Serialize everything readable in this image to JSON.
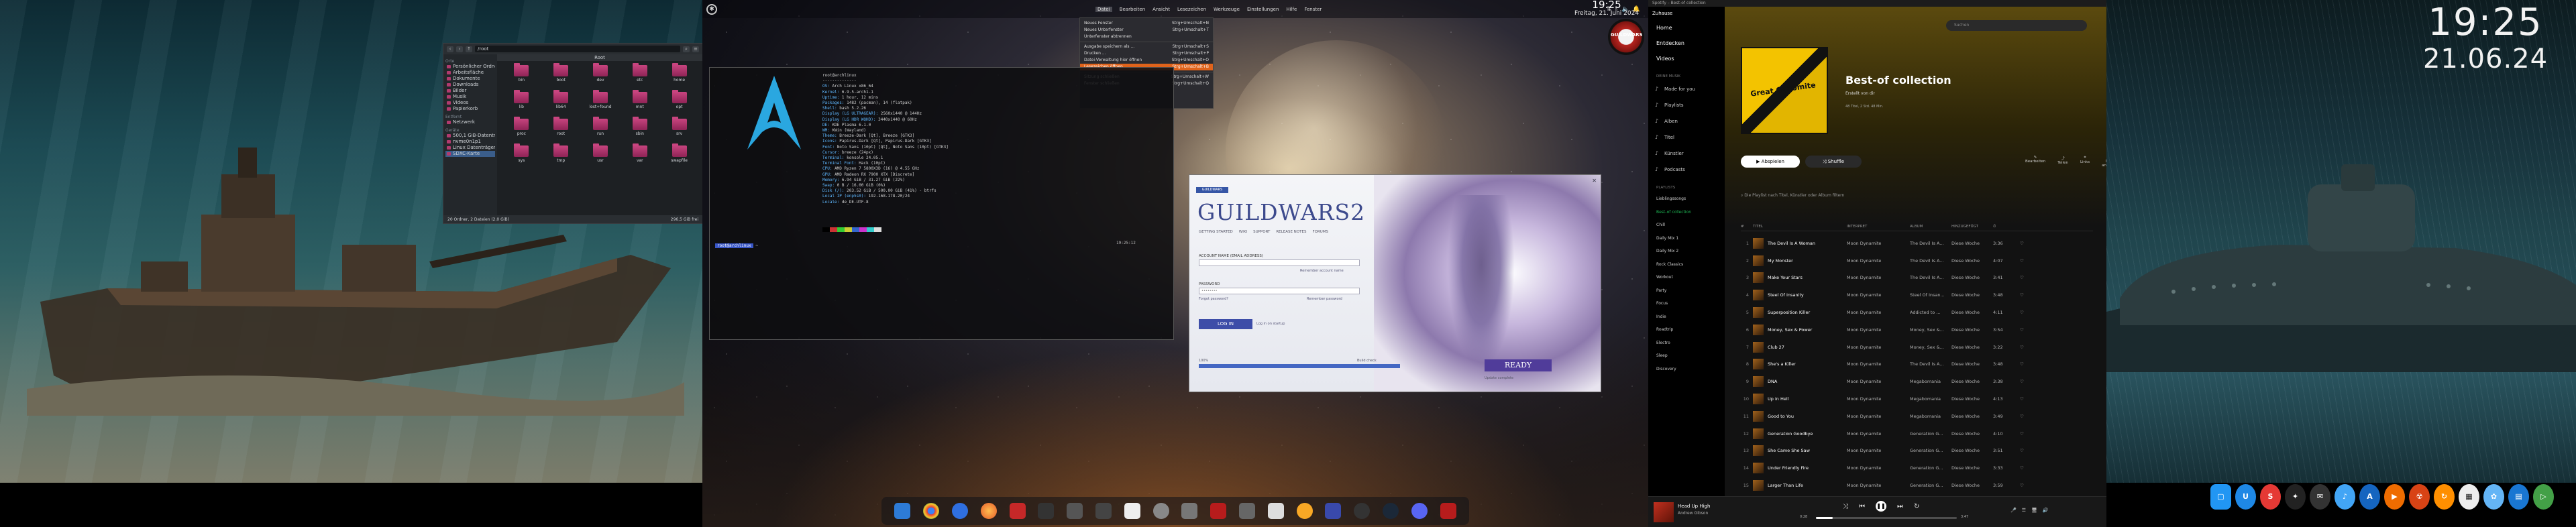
{
  "top_bar": {
    "menus": [
      "Datei",
      "Bearbeiten",
      "Ansicht",
      "Lesezeichen",
      "Werkzeuge",
      "Einstellungen",
      "Hilfe",
      "Fenster"
    ],
    "active_menu": "Datei",
    "time": "19:25",
    "date": "Freitag, 21. Juni 2024",
    "badge_text": "GUILDWARS"
  },
  "file_menu": {
    "items": [
      {
        "label": "Neues Fenster",
        "shortcut": "Strg+Umschalt+N"
      },
      {
        "label": "Neues Unterfenster",
        "shortcut": "Strg+Umschalt+T"
      },
      {
        "label": "Unterfenster abtrennen",
        "shortcut": ""
      },
      {
        "label": "Ausgabe speichern als ...",
        "shortcut": "Strg+Umschalt+S"
      },
      {
        "label": "Drucken ...",
        "shortcut": "Strg+Umschalt+P"
      },
      {
        "label": "Datei-Verwaltung hier öffnen",
        "shortcut": "Strg+Umschalt+O"
      },
      {
        "label": "Lesezeichen öffnen",
        "shortcut": "Strg+Umschalt+B",
        "highlighted": true
      },
      {
        "label": "Sitzung schließen",
        "shortcut": "Strg+Umschalt+W"
      },
      {
        "label": "Fenster schließen",
        "shortcut": "Strg+Umschalt+Q"
      }
    ]
  },
  "file_manager": {
    "path": "/root",
    "tab": "Root",
    "sidebar": {
      "places_title": "Orte",
      "places": [
        "Persönlicher Ordner",
        "Arbeitsfläche",
        "Dokumente",
        "Downloads",
        "Bilder",
        "Musik",
        "Videos",
        "Papierkorb"
      ],
      "remote_title": "Entfernt",
      "remote": [
        "Netzwerk"
      ],
      "devices_title": "Geräte",
      "devices": [
        "500,1 GiB-Datenträger",
        "nvme0n1p1",
        "Linux Datenträger",
        "SDXC-Karte"
      ],
      "selected": "SDXC-Karte"
    },
    "folders": [
      "bin",
      "boot",
      "dev",
      "etc",
      "home",
      "lib",
      "lib64",
      "lost+found",
      "mnt",
      "opt",
      "proc",
      "root",
      "run",
      "sbin",
      "srv",
      "sys",
      "tmp",
      "usr",
      "var",
      "swapfile"
    ],
    "status_left": "20 Ordner, 2 Dateien (2,0 GiB)",
    "status_right": "296,5 GiB frei"
  },
  "terminal": {
    "info_lines": [
      {
        "k": "",
        "v": "root@archlinux"
      },
      {
        "k": "",
        "v": "--------------"
      },
      {
        "k": "OS:",
        "v": "Arch Linux x86_64"
      },
      {
        "k": "Kernel:",
        "v": "6.9.5-arch1-1"
      },
      {
        "k": "Uptime:",
        "v": "1 hour, 12 mins"
      },
      {
        "k": "Packages:",
        "v": "1482 (pacman), 14 (flatpak)"
      },
      {
        "k": "Shell:",
        "v": "bash 5.2.26"
      },
      {
        "k": "Display (LG ULTRAGEAR):",
        "v": "2560x1440 @ 144Hz"
      },
      {
        "k": "Display (LG HDR WQHD):",
        "v": "3440x1440 @ 60Hz"
      },
      {
        "k": "DE:",
        "v": "KDE Plasma 6.1.0"
      },
      {
        "k": "WM:",
        "v": "KWin (Wayland)"
      },
      {
        "k": "Theme:",
        "v": "Breeze-Dark [Qt], Breeze [GTK3]"
      },
      {
        "k": "Icons:",
        "v": "Papirus-Dark [Qt], Papirus-Dark [GTK3]"
      },
      {
        "k": "Font:",
        "v": "Noto Sans (10pt) [Qt], Noto Sans (10pt) [GTK3]"
      },
      {
        "k": "Cursor:",
        "v": "breeze (24px)"
      },
      {
        "k": "Terminal:",
        "v": "konsole 24.05.1"
      },
      {
        "k": "Terminal Font:",
        "v": "Hack (10pt)"
      },
      {
        "k": "CPU:",
        "v": "AMD Ryzen 7 5800X3D (16) @ 4.55 GHz"
      },
      {
        "k": "GPU:",
        "v": "AMD Radeon RX 7900 XTX [Discrete]"
      },
      {
        "k": "Memory:",
        "v": "6.94 GiB / 31.27 GiB (22%)"
      },
      {
        "k": "Swap:",
        "v": "0 B / 16.00 GiB (0%)"
      },
      {
        "k": "Disk (/):",
        "v": "203.52 GiB / 500.00 GiB (41%) - btrfs"
      },
      {
        "k": "Local IP (enp5s0):",
        "v": "192.168.178.20/24"
      },
      {
        "k": "Locale:",
        "v": "de_DE.UTF-8"
      }
    ],
    "prompt_user": "root@archlinux",
    "prompt_dir": "~",
    "prompt_time": "19:25:12"
  },
  "gw2_launcher": {
    "tag": "GUILDWARS",
    "title": "GUILDWARS2",
    "nav": [
      "GETTING STARTED",
      "WIKI",
      "SUPPORT",
      "RELEASE NOTES",
      "FORUMS"
    ],
    "account_label": "ACCOUNT NAME (EMAIL ADDRESS)",
    "account_placeholder": "",
    "forgot_account": "Remember account name",
    "password_label": "PASSWORD",
    "password_value": "••••••••",
    "forgot_password": "Forgot password?",
    "remember_password": "Remember password",
    "login": "LOG IN",
    "remember_me": "Log in on startup",
    "progress_label": "100%",
    "progress": 1.0,
    "progress_note": "Build check",
    "ready": "READY",
    "footer": "Update complete"
  },
  "spotify": {
    "title": "Spotify – Best-of collection",
    "sidebar_head": "Zuhause",
    "nav": [
      "Home",
      "Entdecken",
      "Videos"
    ],
    "library_title": "DEINE MUSIK",
    "library": [
      "Made for you",
      "Playlists",
      "Alben",
      "Titel",
      "Künstler",
      "Podcasts"
    ],
    "playlists_title": "PLAYLISTS",
    "playlists": [
      "Lieblingssongs",
      "Best-of collection",
      "Chill",
      "Daily Mix 1",
      "Daily Mix 2",
      "Rock Classics",
      "Workout",
      "Party",
      "Focus",
      "Indie",
      "Roadtrip",
      "Electro",
      "Sleep",
      "Discovery"
    ],
    "active_playlist": "Best-of collection",
    "search_placeholder": "Suchen",
    "cover_text": "Great Gynomite",
    "playlist_title": "Best-of collection",
    "playlist_sub": "Erstellt von dir",
    "playlist_meta": "48 Titel, 2 Std. 48 Min.",
    "play": "Abspielen",
    "shuffle": "Shuffle",
    "actions": [
      "Bearbeiten",
      "Teilen",
      "Links",
      "Mehr anzeigen"
    ],
    "filter": "Die Playlist nach Titel, Künstler oder Album filtern",
    "columns": [
      "#",
      "TITEL",
      "INTERPRET",
      "ALBUM",
      "HINZUGEFÜGT",
      "⏱"
    ],
    "tracks": [
      {
        "n": "1",
        "t": "The Devil Is A Woman",
        "a": "Moon Dynamite",
        "al": "The Devil Is A...",
        "d": "Diese Woche",
        "du": "3:36"
      },
      {
        "n": "2",
        "t": "My Monster",
        "a": "Moon Dynamite",
        "al": "The Devil Is A...",
        "d": "Diese Woche",
        "du": "4:07"
      },
      {
        "n": "3",
        "t": "Make Your Stars",
        "a": "Moon Dynamite",
        "al": "The Devil Is A...",
        "d": "Diese Woche",
        "du": "3:41"
      },
      {
        "n": "4",
        "t": "Steel Of Insanity",
        "a": "Moon Dynamite",
        "al": "Steel Of Insan...",
        "d": "Diese Woche",
        "du": "3:48"
      },
      {
        "n": "5",
        "t": "Superposition Killer",
        "a": "Moon Dynamite",
        "al": "Addicted to ...",
        "d": "Diese Woche",
        "du": "4:11"
      },
      {
        "n": "6",
        "t": "Money, Sex & Power",
        "a": "Moon Dynamite",
        "al": "Money, Sex &...",
        "d": "Diese Woche",
        "du": "3:54"
      },
      {
        "n": "7",
        "t": "Club 27",
        "a": "Moon Dynamite",
        "al": "Money, Sex &...",
        "d": "Diese Woche",
        "du": "3:22"
      },
      {
        "n": "8",
        "t": "She's a Killer",
        "a": "Moon Dynamite",
        "al": "The Devil Is A...",
        "d": "Diese Woche",
        "du": "3:48"
      },
      {
        "n": "9",
        "t": "DNA",
        "a": "Moon Dynamite",
        "al": "Megabomania",
        "d": "Diese Woche",
        "du": "3:38"
      },
      {
        "n": "10",
        "t": "Up in Hell",
        "a": "Moon Dynamite",
        "al": "Megabomania",
        "d": "Diese Woche",
        "du": "4:13"
      },
      {
        "n": "11",
        "t": "Good to You",
        "a": "Moon Dynamite",
        "al": "Megabomania",
        "d": "Diese Woche",
        "du": "3:49"
      },
      {
        "n": "12",
        "t": "Generation Goodbye",
        "a": "Moon Dynamite",
        "al": "Generation G...",
        "d": "Diese Woche",
        "du": "4:10"
      },
      {
        "n": "13",
        "t": "She Came She Saw",
        "a": "Moon Dynamite",
        "al": "Generation G...",
        "d": "Diese Woche",
        "du": "3:51"
      },
      {
        "n": "14",
        "t": "Under Friendly Fire",
        "a": "Moon Dynamite",
        "al": "Generation G...",
        "d": "Diese Woche",
        "du": "3:33"
      },
      {
        "n": "15",
        "t": "Larger Than Life",
        "a": "Moon Dynamite",
        "al": "Generation G...",
        "d": "Diese Woche",
        "du": "3:59"
      }
    ],
    "now_playing_title": "Head Up High",
    "now_playing_artist": "Andrew Gibson",
    "progress": 0.12,
    "time_elapsed": "0:28",
    "time_total": "3:47"
  },
  "desktop4": {
    "time": "19:25",
    "date": "21.06.24"
  },
  "colors": {
    "spotify_green": "#1db954",
    "menu_highlight": "#e0631b",
    "gw_blue": "#3d4da8"
  }
}
